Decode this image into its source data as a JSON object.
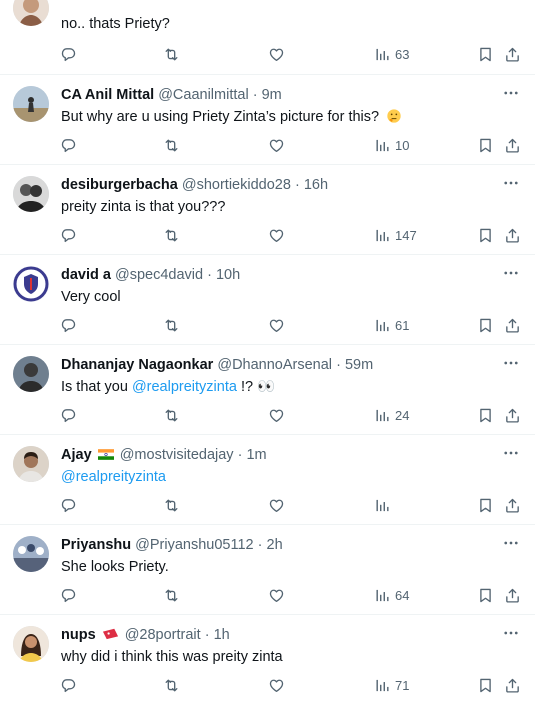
{
  "replies": [
    {
      "text": "no.. thats Priety?",
      "views": "63"
    },
    {
      "name": "CA Anil Mittal",
      "handle": "@Caanilmittal",
      "sep": "·",
      "time": "9m",
      "text": "But why are u using Priety Zinta’s picture for this?",
      "emoji": "thinking-face-emoji",
      "views": "10"
    },
    {
      "name": "desiburgerbacha",
      "handle": "@shortiekiddo28",
      "sep": "·",
      "time": "16h",
      "text": "preity zinta is that you???",
      "views": "147"
    },
    {
      "name": "david a",
      "handle": "@spec4david",
      "sep": "·",
      "time": "10h",
      "text": "Very cool",
      "views": "61"
    },
    {
      "name": "Dhananjay Nagaonkar",
      "handle": "@DhannoArsenal",
      "sep": "·",
      "time": "59m",
      "text_before": "Is that you ",
      "mention": "@realpreityzinta",
      "text_after": " !? 👀",
      "views": "24"
    },
    {
      "name": "Ajay",
      "handle": "@mostvisitedajay",
      "sep": "·",
      "time": "1m",
      "mention": "@realpreityzinta",
      "views": ""
    },
    {
      "name": "Priyanshu",
      "handle": "@Priyanshu05112",
      "sep": "·",
      "time": "2h",
      "text": "She looks Priety.",
      "views": "64"
    },
    {
      "name": "nups",
      "handle": "@28portrait",
      "sep": "·",
      "time": "1h",
      "text": "why did i think this was preity zinta",
      "views": "71"
    }
  ],
  "colors": {
    "text": "#0f1419",
    "secondary": "#536471",
    "link": "#1d9bf0",
    "divider": "#eff3f4"
  }
}
